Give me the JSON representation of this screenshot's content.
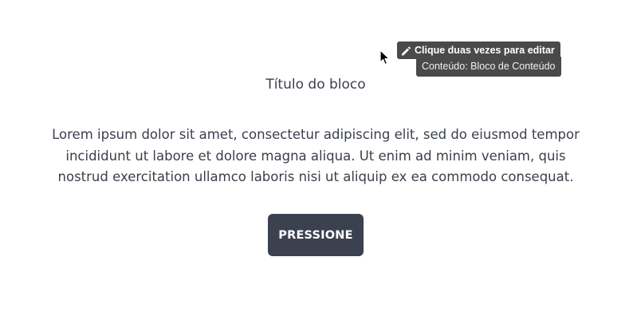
{
  "editor": {
    "edit_hint": "Clique duas vezes para editar",
    "content_label": "Conteúdo: Bloco de Conteúdo",
    "edit_icon": "pencil-icon",
    "cursor_icon": "mouse-pointer-icon"
  },
  "block": {
    "title": "Título do bloco",
    "body": "Lorem ipsum dolor sit amet, consectetur adipiscing elit, sed do eiusmod tempor incididunt ut labore et dolore magna aliqua. Ut enim ad minim veniam, quis nostrud exercitation ullamco laboris nisi ut aliquip ex ea commodo consequat.",
    "button_label": "PRESSIONE"
  },
  "colors": {
    "button_bg": "#3c4150",
    "text": "#3a3f4b",
    "tooltip_bg": "#4a4a4a"
  }
}
